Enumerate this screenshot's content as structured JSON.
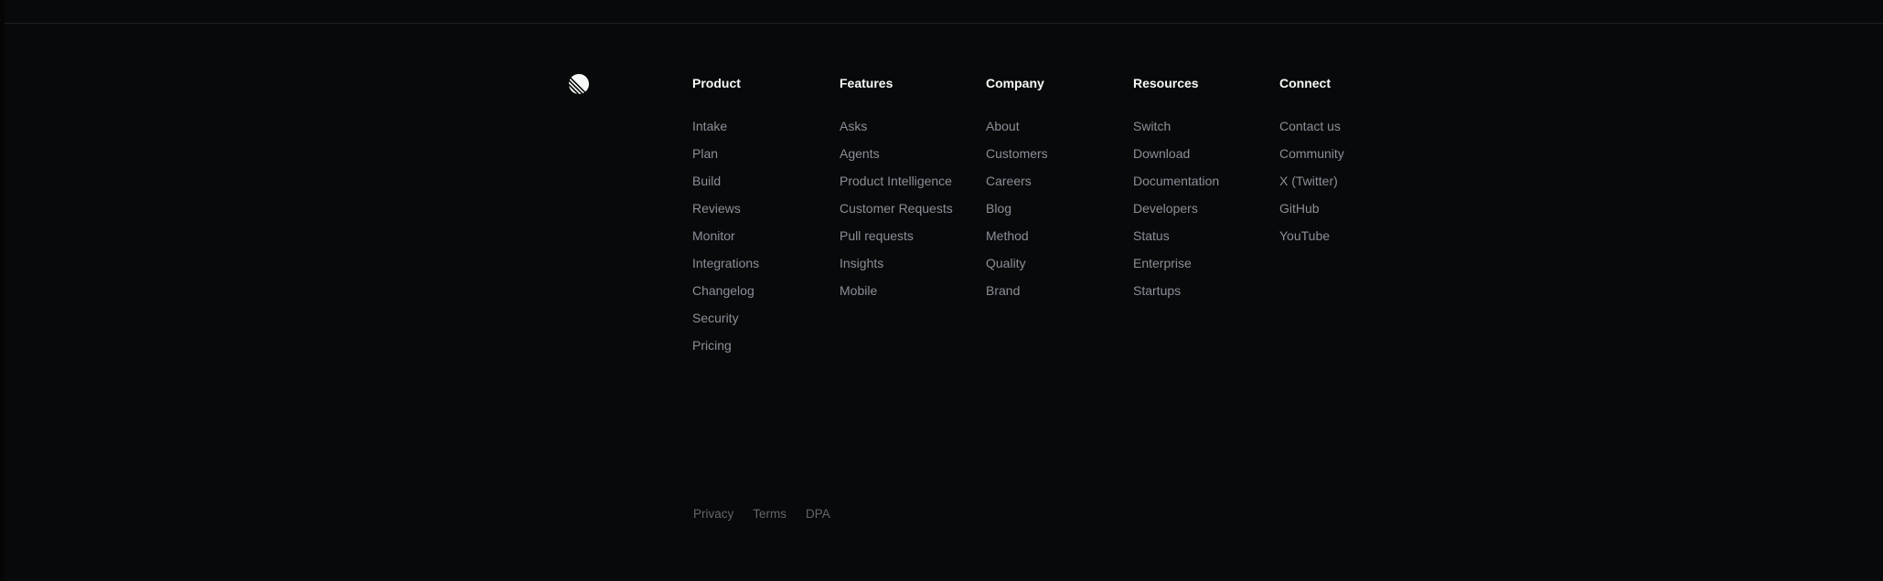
{
  "brand": {
    "logo_icon": "linear-logo-icon",
    "logo_color": "#f7f8f8"
  },
  "colors": {
    "background": "#08090a",
    "heading": "#f7f8f8",
    "link": "#8a8f98",
    "legal_link": "#62666d",
    "divider": "#1f2023"
  },
  "footer": {
    "columns": [
      {
        "title": "Product",
        "links": [
          "Intake",
          "Plan",
          "Build",
          "Reviews",
          "Monitor",
          "Integrations",
          "Changelog",
          "Security",
          "Pricing"
        ]
      },
      {
        "title": "Features",
        "links": [
          "Asks",
          "Agents",
          "Product Intelligence",
          "Customer Requests",
          "Pull requests",
          "Insights",
          "Mobile"
        ]
      },
      {
        "title": "Company",
        "links": [
          "About",
          "Customers",
          "Careers",
          "Blog",
          "Method",
          "Quality",
          "Brand"
        ]
      },
      {
        "title": "Resources",
        "links": [
          "Switch",
          "Download",
          "Documentation",
          "Developers",
          "Status",
          "Enterprise",
          "Startups"
        ]
      },
      {
        "title": "Connect",
        "links": [
          "Contact us",
          "Community",
          "X (Twitter)",
          "GitHub",
          "YouTube"
        ]
      }
    ],
    "legal": [
      "Privacy",
      "Terms",
      "DPA"
    ]
  }
}
